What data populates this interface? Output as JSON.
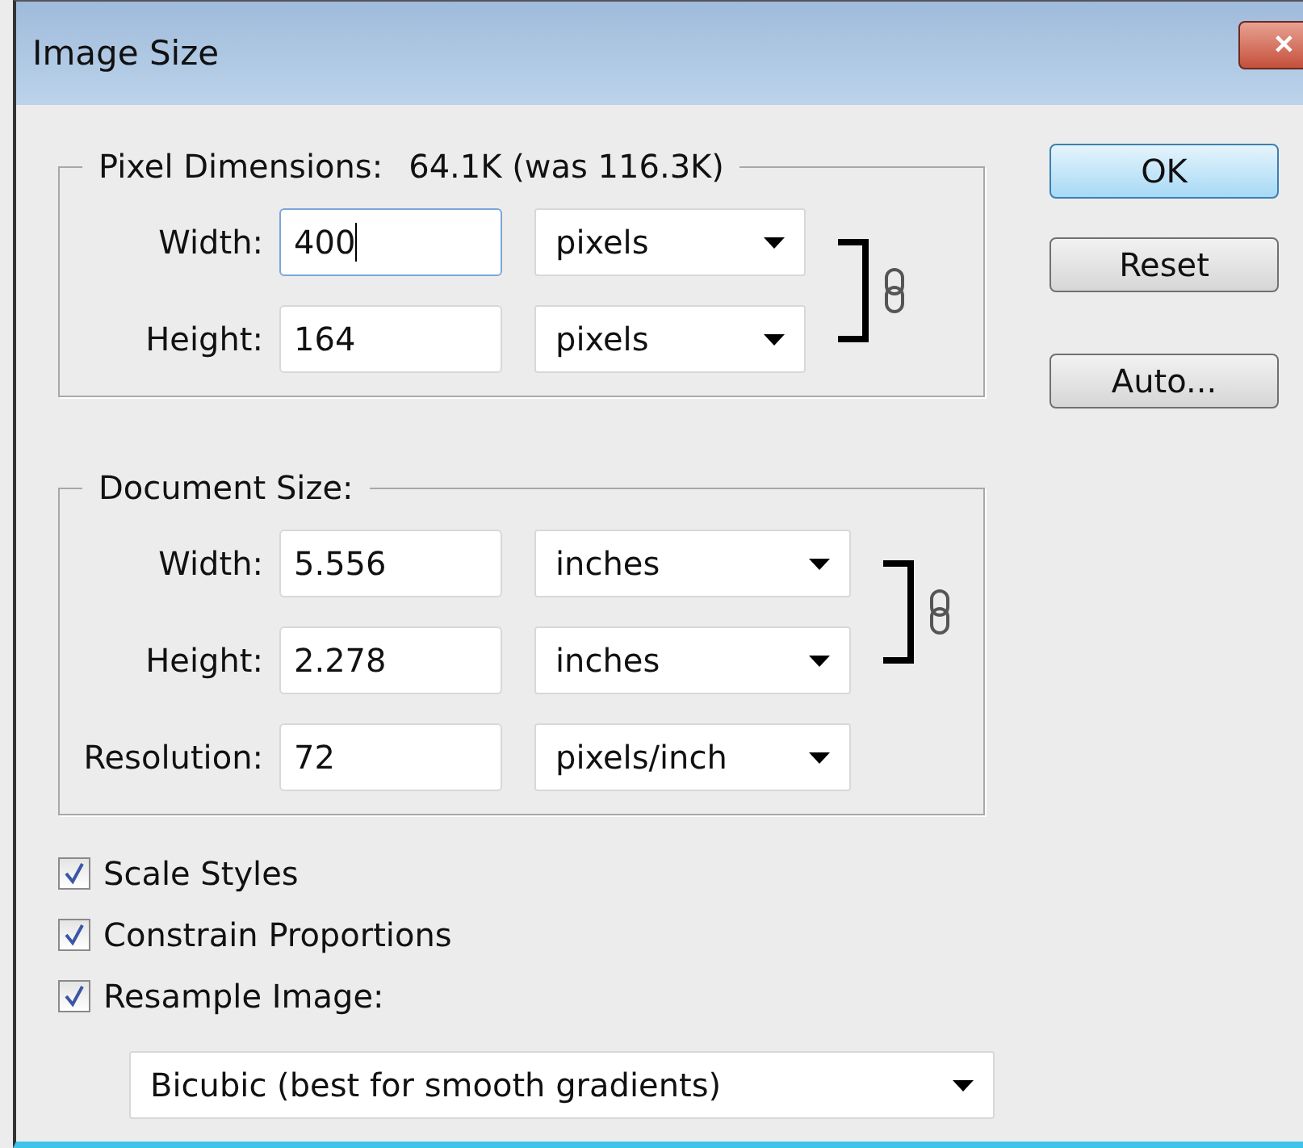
{
  "window": {
    "title": "Image Size",
    "close": "✕"
  },
  "pixel_dimensions": {
    "label": "Pixel Dimensions:",
    "value": "64.1K (was 116.3K)",
    "constrained": true,
    "rows": [
      {
        "label": "Width:",
        "value": "400",
        "focused": true,
        "unit": "pixels"
      },
      {
        "label": "Height:",
        "value": "164",
        "focused": false,
        "unit": "pixels"
      }
    ]
  },
  "document_size": {
    "label": "Document Size:",
    "constrained": true,
    "rows": [
      {
        "label": "Width:",
        "value": "5.556",
        "focused": false,
        "unit": "inches"
      },
      {
        "label": "Height:",
        "value": "2.278",
        "focused": false,
        "unit": "inches"
      }
    ],
    "resolution": {
      "label": "Resolution:",
      "value": "72",
      "focused": false,
      "unit": "pixels/inch"
    }
  },
  "options": [
    {
      "label": "Scale Styles",
      "checked": true
    },
    {
      "label": "Constrain Proportions",
      "checked": true
    },
    {
      "label": "Resample Image:",
      "checked": true
    }
  ],
  "resample_method": "Bicubic (best for smooth gradients)",
  "buttons": [
    {
      "label": "OK",
      "default": true
    },
    {
      "label": "Reset",
      "default": false
    },
    {
      "label": "Auto...",
      "default": false
    }
  ]
}
